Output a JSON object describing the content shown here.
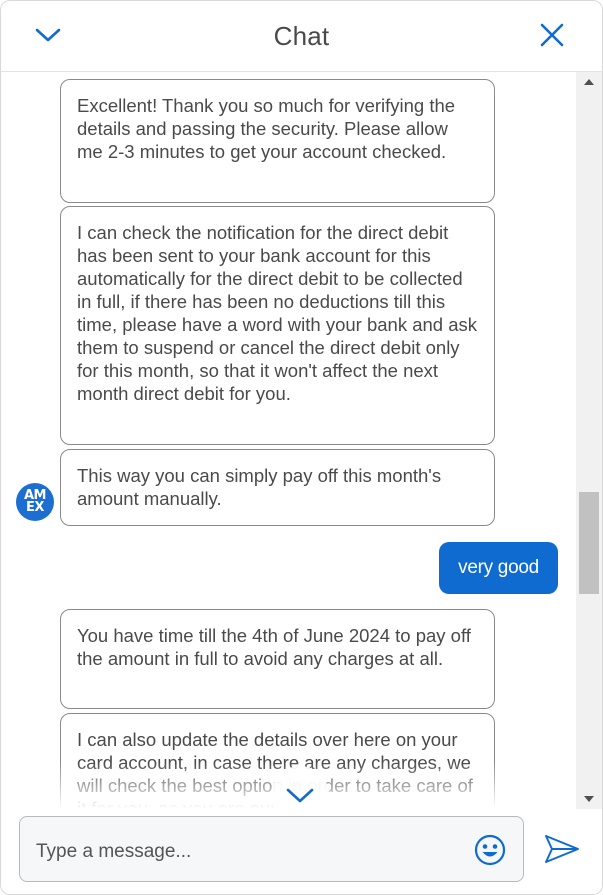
{
  "header": {
    "title": "Chat",
    "minimize_icon": "chevron-down-icon",
    "close_icon": "close-icon"
  },
  "colors": {
    "accent": "#0f6bd0",
    "bubble_border": "#8a8a8a",
    "text": "#4a4a4a"
  },
  "messages": [
    {
      "from": "agent",
      "text": "Excellent! Thank you so much for verifying the details and passing the security. Please allow me 2-3 minutes to get your account checked."
    },
    {
      "from": "agent",
      "text": "I can check the notification for the direct debit has been sent to your bank account for this automatically for the direct debit to be collected in full, if there has been no deductions till this time, please have a word with your bank and ask them to suspend or cancel the direct debit only for this month, so that it won't affect the next month direct debit for you."
    },
    {
      "from": "agent",
      "text": "This way you can simply pay off this month's amount manually."
    },
    {
      "from": "user",
      "text": "very good"
    },
    {
      "from": "agent",
      "text": "You have time till the 4th of June 2024 to pay off the amount in full to avoid any charges at all."
    },
    {
      "from": "agent",
      "text": "I can also update the details over here on your card account, in case there are any charges, we will check the best option in order to take care of it for you, as you are our"
    }
  ],
  "avatar": {
    "line1": "AM",
    "line2": "EX",
    "icon": "amex-logo-icon"
  },
  "composer": {
    "placeholder": "Type a message...",
    "emoji_icon": "smiley-icon",
    "send_icon": "send-icon"
  }
}
